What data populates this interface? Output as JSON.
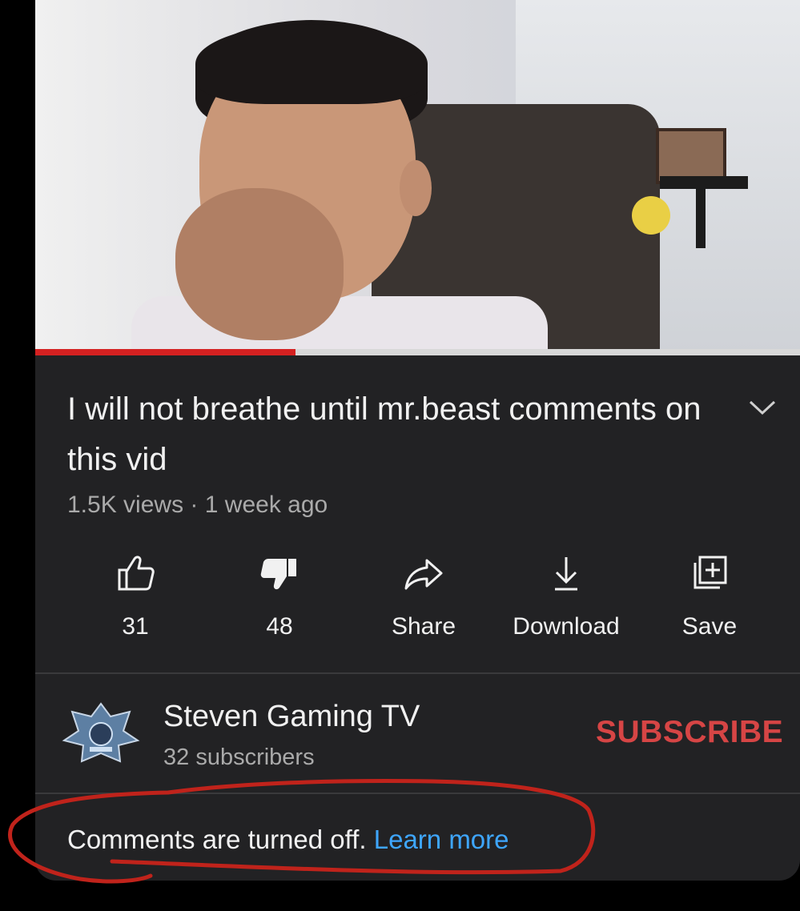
{
  "video": {
    "title": "I will not breathe until mr.beast comments on this vid",
    "views": "1.5K views",
    "separator": "·",
    "age": "1 week ago",
    "progress": 0.34
  },
  "actions": {
    "like_count": "31",
    "dislike_count": "48",
    "share_label": "Share",
    "download_label": "Download",
    "save_label": "Save"
  },
  "channel": {
    "name": "Steven Gaming TV",
    "subscribers": "32 subscribers",
    "subscribe_label": "SUBSCRIBE"
  },
  "comments": {
    "status": "Comments are turned off.",
    "learn_more": "Learn more"
  },
  "colors": {
    "background": "#222224",
    "text": "#f1f1f1",
    "secondary_text": "#aaaaaa",
    "subscribe": "#d64545",
    "link": "#3ea6ff",
    "progress_played": "#d42121",
    "annotation": "#c0231b"
  }
}
